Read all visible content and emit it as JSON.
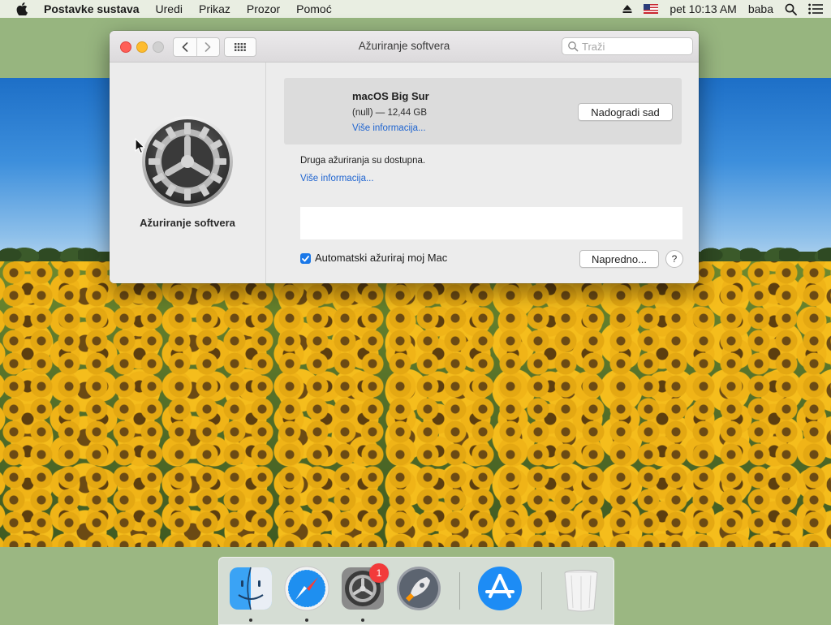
{
  "menubar": {
    "app_name": "Postavke sustava",
    "items": [
      "Uredi",
      "Prikaz",
      "Prozor",
      "Pomoć"
    ],
    "clock": "pet 10:13 AM",
    "user": "baba",
    "input_source_icon": "us-flag-icon"
  },
  "window": {
    "title": "Ažuriranje softvera",
    "search_placeholder": "Traži",
    "sidebar_label": "Ažuriranje softvera",
    "update": {
      "title": "macOS Big Sur",
      "size": "(null) — 12,44 GB",
      "more_info": "Više informacija...",
      "upgrade_button": "Nadogradi sad"
    },
    "other_updates": {
      "text": "Druga ažuriranja su dostupna.",
      "more_info": "Više informacija..."
    },
    "auto_update": {
      "label": "Automatski ažuriraj moj Mac",
      "checked": true
    },
    "advanced_button": "Napredno...",
    "help_button": "?"
  },
  "dock": {
    "apps": [
      "finder",
      "safari",
      "system-preferences",
      "launchpad",
      "app-store",
      "trash"
    ],
    "system_preferences_badge": "1"
  },
  "colors": {
    "accent": "#1a78e8",
    "link": "#1e64d0",
    "close": "#ff5f57",
    "minimize": "#febc2e",
    "badge": "#f23b3b"
  }
}
